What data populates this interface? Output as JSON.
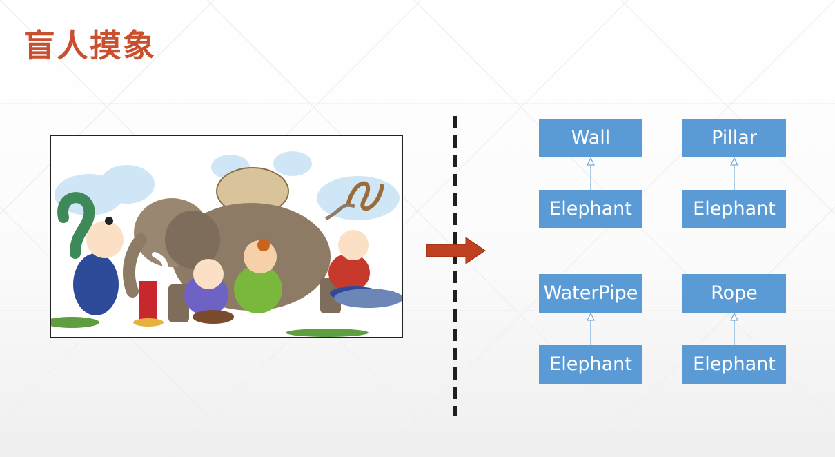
{
  "title": "盲人摸象",
  "colors": {
    "title": "#c9502f",
    "box": "#5b9bd5",
    "arrow": "#c0411f",
    "connector": "#5b9bd5"
  },
  "illustration": {
    "icon": "blind-men-and-elephant-illustration"
  },
  "diagrams": [
    {
      "parent": "Wall",
      "child": "Elephant"
    },
    {
      "parent": "Pillar",
      "child": "Elephant"
    },
    {
      "parent": "WaterPipe",
      "child": "Elephant"
    },
    {
      "parent": "Rope",
      "child": "Elephant"
    }
  ]
}
